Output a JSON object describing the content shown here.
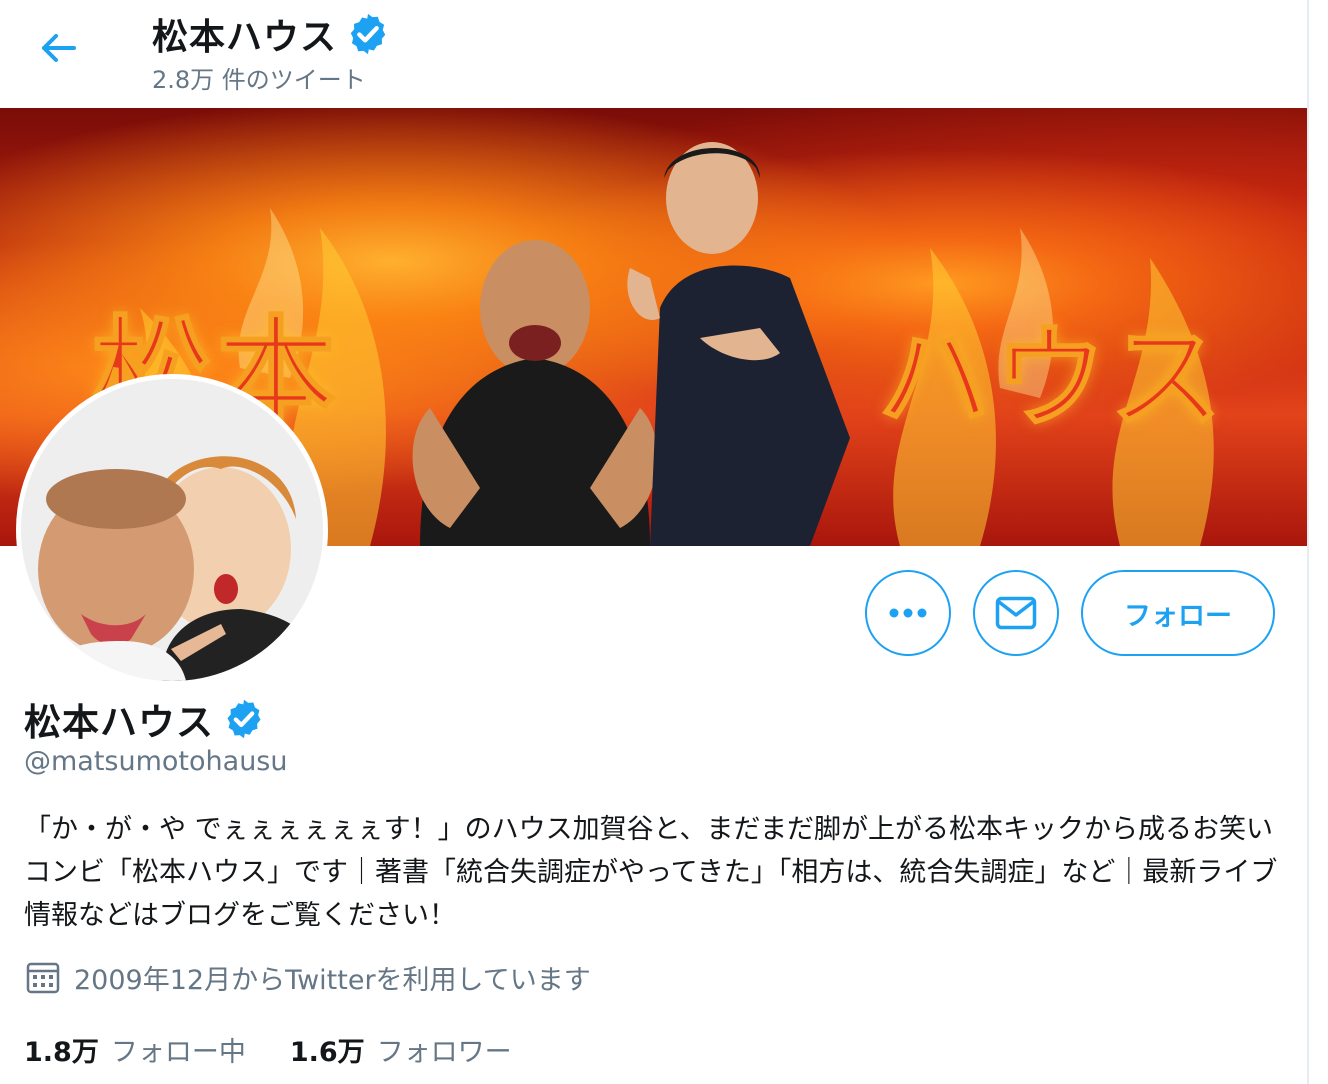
{
  "header": {
    "title": "松本ハウス",
    "tweet_count": "2.8万 件のツイート",
    "back_icon": "arrow-left-icon"
  },
  "banner": {
    "text_left": "松本",
    "text_right": "ハウス"
  },
  "profile": {
    "name": "松本ハウス",
    "handle": "@matsumotohausu",
    "verified": true,
    "bio": "「か・が・や でぇぇぇぇぇぇす！」のハウス加賀谷と、まだまだ脚が上がる松本キックから成るお笑いコンビ「松本ハウス」です｜著書「統合失調症がやってきた」「相方は、統合失調症」など｜最新ライブ情報などはブログをご覧ください！",
    "joined": "2009年12月からTwitterを利用しています"
  },
  "actions": {
    "more_icon": "more-horizontal-icon",
    "message_icon": "envelope-icon",
    "follow_label": "フォロー"
  },
  "stats": {
    "following_count": "1.8万",
    "following_label": "フォロー中",
    "followers_count": "1.6万",
    "followers_label": "フォロワー"
  },
  "colors": {
    "accent": "#1da1f2",
    "secondary_text": "#657786",
    "primary_text": "#14171a"
  }
}
